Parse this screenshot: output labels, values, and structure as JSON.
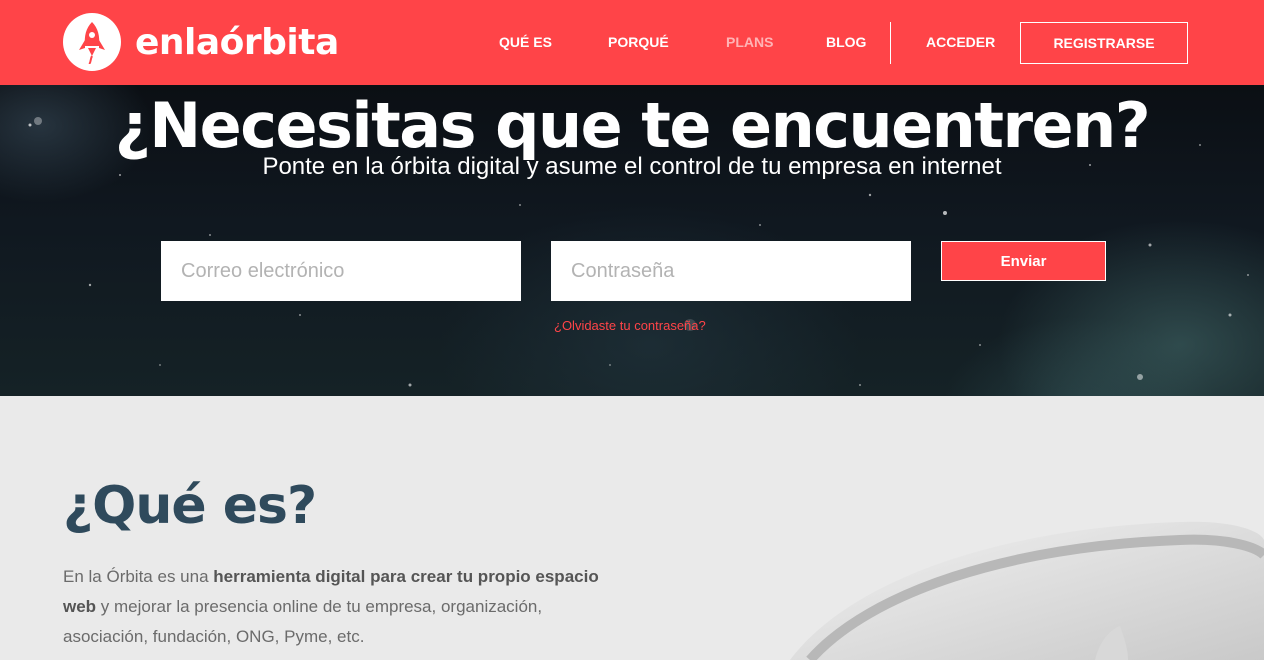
{
  "header": {
    "brand": "enlaórbita",
    "nav": [
      {
        "label": "QUÉ ES"
      },
      {
        "label": "PORQUÉ"
      },
      {
        "label": "PLANS"
      },
      {
        "label": "BLOG"
      },
      {
        "label": "ACCEDER"
      }
    ],
    "register_label": "REGISTRARSE"
  },
  "hero": {
    "title": "¿Necesitas que te encuentren?",
    "subtitle": "Ponte en la órbita digital y asume el control de tu empresa en internet",
    "email_placeholder": "Correo electrónico",
    "password_placeholder": "Contraseña",
    "submit_label": "Enviar",
    "forgot_label": "¿Olvidaste tu contraseña?"
  },
  "section": {
    "title": "¿Qué es?",
    "text_before": "En la Órbita es una ",
    "text_bold": "herramienta digital para crear tu propio espacio web",
    "text_after": " y mejorar la presencia online de tu empresa, organización, asociación, fundación, ONG, Pyme, etc."
  },
  "colors": {
    "brand_red": "#ff4448",
    "heading_blue": "#2f4a5c",
    "section_bg": "#eaeaea"
  },
  "icons": {
    "logo": "rocket-icon"
  }
}
